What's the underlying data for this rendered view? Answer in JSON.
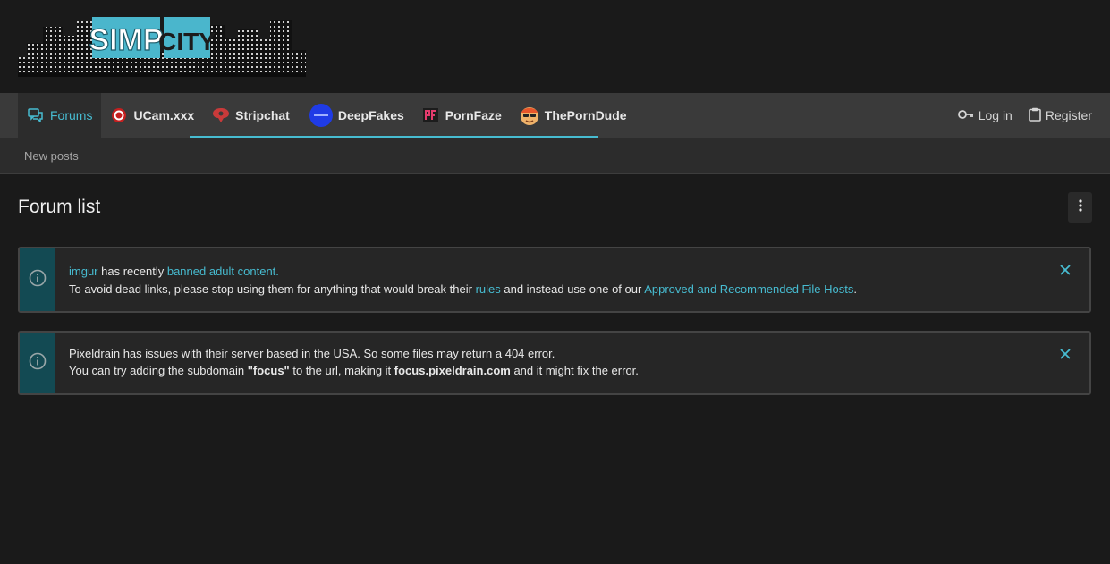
{
  "logo": {
    "text_left": "SIMP",
    "text_right": "CITY"
  },
  "nav": {
    "tabs": [
      {
        "label": "Forums",
        "icon": "forums-icon"
      },
      {
        "label": "UCam.xxx",
        "icon": "ucam-icon"
      },
      {
        "label": "Stripchat",
        "icon": "stripchat-icon"
      },
      {
        "label": "DeepFakes",
        "icon": "deepfakes-icon"
      },
      {
        "label": "PornFaze",
        "icon": "pornfaze-icon"
      },
      {
        "label": "ThePornDude",
        "icon": "theporndude-icon"
      }
    ],
    "login_label": "Log in",
    "register_label": "Register"
  },
  "subnav": {
    "new_posts": "New posts"
  },
  "page": {
    "title": "Forum list"
  },
  "notices": [
    {
      "line1": {
        "link1": "imgur",
        "text1": " has recently ",
        "link2": "banned adult content."
      },
      "line2": {
        "text1": "To avoid dead links, please stop using them for anything that would break their ",
        "link1": "rules",
        "text2": " and instead use one of our ",
        "link2": "Approved and Recommended File Hosts",
        "text3": "."
      }
    },
    {
      "line1": {
        "text1": "Pixeldrain has issues with their server based in the USA. So some files may return a 404 error."
      },
      "line2": {
        "text1": "You can try adding the subdomain ",
        "bold1": "\"focus\"",
        "text2": " to the url, making it ",
        "bold2": "focus.pixeldrain.com",
        "text3": " and it might fix the error."
      }
    }
  ],
  "colors": {
    "accent": "#47bcd1",
    "notice_side": "#134a53",
    "nav_bg": "#3a3a3a",
    "page_bg": "#1a1a1a"
  }
}
